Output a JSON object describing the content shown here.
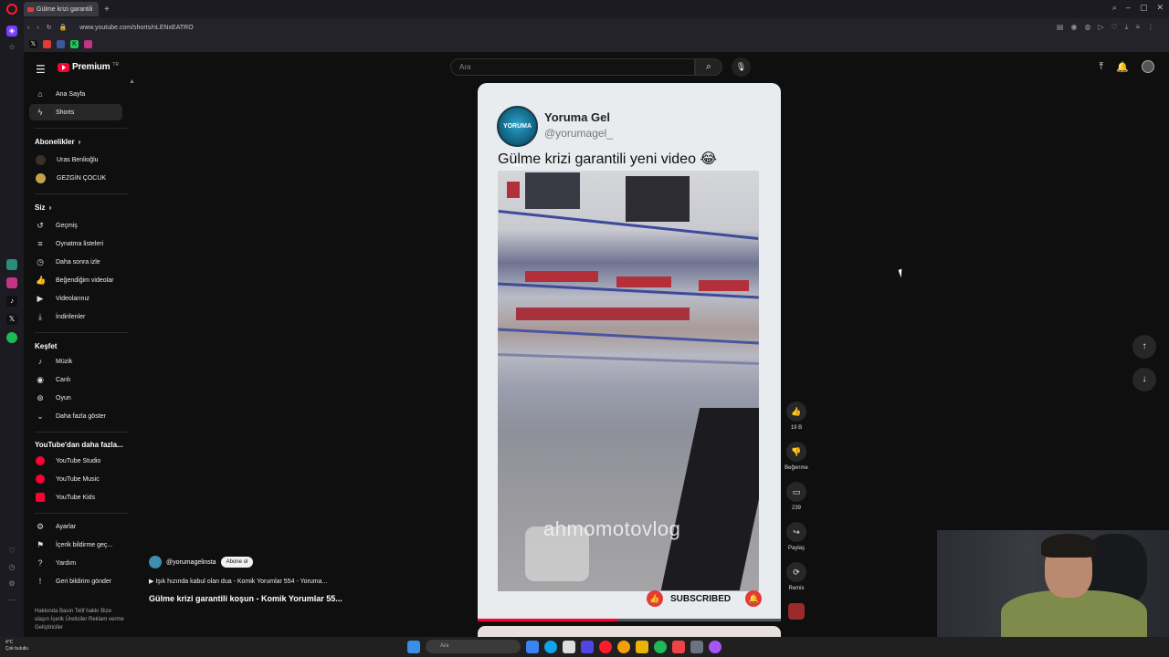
{
  "browser": {
    "tab_title": "Gülme krizi garantili",
    "url": "www.youtube.com/shorts/nLENxEATRO"
  },
  "youtube": {
    "logo_text": "Premium",
    "logo_tm": "TR",
    "search_placeholder": "Ara"
  },
  "sidebar": {
    "main": [
      {
        "label": "Ana Sayfa",
        "icon": "home-icon"
      },
      {
        "label": "Shorts",
        "icon": "shorts-icon"
      }
    ],
    "subscriptions_header": "Abonelikler",
    "subscriptions": [
      {
        "label": "Uras Benlioğlu"
      },
      {
        "label": "GEZGİN ÇOCUK"
      }
    ],
    "you_header": "Siz",
    "you": [
      {
        "label": "Geçmiş",
        "icon": "history-icon"
      },
      {
        "label": "Oynatma listeleri",
        "icon": "playlist-icon"
      },
      {
        "label": "Daha sonra izle",
        "icon": "clock-icon"
      },
      {
        "label": "Beğendiğim videolar",
        "icon": "thumbs-up-icon"
      },
      {
        "label": "Videolarınız",
        "icon": "video-icon"
      },
      {
        "label": "İndirilenler",
        "icon": "download-icon"
      }
    ],
    "explore_header": "Keşfet",
    "explore": [
      {
        "label": "Müzik",
        "icon": "music-icon"
      },
      {
        "label": "Canlı",
        "icon": "live-icon"
      },
      {
        "label": "Oyun",
        "icon": "gaming-icon"
      },
      {
        "label": "Daha fazla göster",
        "icon": "chevron-down-icon"
      }
    ],
    "more_header": "YouTube'dan daha fazla...",
    "more": [
      {
        "label": "YouTube Studio"
      },
      {
        "label": "YouTube Music"
      },
      {
        "label": "YouTube Kids"
      }
    ],
    "settings": [
      {
        "label": "Ayarlar",
        "icon": "gear-icon"
      },
      {
        "label": "İçerik bildirme geç...",
        "icon": "flag-icon"
      },
      {
        "label": "Yardım",
        "icon": "help-icon"
      },
      {
        "label": "Geri bildirim gönder",
        "icon": "feedback-icon"
      }
    ],
    "footer": "Hakkında  Basın  Telif hakkı  Bize ulaşın  İçerik Üreticiler  Reklam verme  Geliştiriciler"
  },
  "short": {
    "avatar_text": "YORUMA GEL",
    "channel_name": "Yoruma Gel",
    "channel_handle": "@yorumagel_",
    "title": "Gülme krizi garantili yeni video 😂",
    "watermark": "ahmomotovlog",
    "subscribed_label": "SUBSCRIBED",
    "progress": 0.46
  },
  "actions": {
    "likes": "19 B",
    "dislike_label": "Beğenme",
    "comments": "239",
    "share_label": "Paylaş",
    "remix_label": "Remix"
  },
  "overlay": {
    "channel": "@yorumagelinsta",
    "subscribe_label": "Abone ol",
    "music": "Işık hızında kabul olan dua - Komik Yorumlar 554 - Yoruma...",
    "title": "Gülme krizi garantili koşun - Komik Yorumlar 55..."
  },
  "taskbar": {
    "weather_temp": "4°C",
    "weather_text": "Çok bulutlu",
    "search_placeholder": "Ara"
  }
}
